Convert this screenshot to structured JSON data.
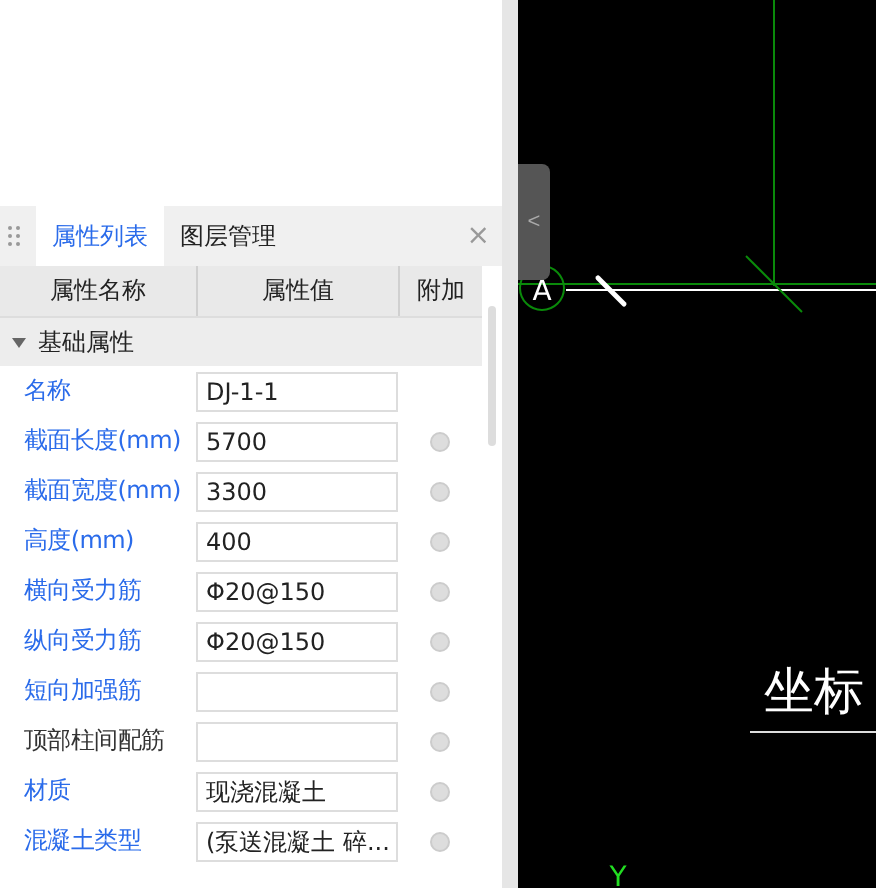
{
  "panel": {
    "tabs": [
      {
        "label": "属性列表",
        "selected": true
      },
      {
        "label": "图层管理",
        "selected": false
      }
    ],
    "close": "×",
    "columns": [
      "属性名称",
      "属性值",
      "附加"
    ],
    "group": {
      "label": "基础属性",
      "expanded": true
    },
    "rows": [
      {
        "name": "名称",
        "value": "DJ-1-1",
        "color": "#2a6bea",
        "attach": false
      },
      {
        "name": "截面长度(mm)",
        "value": "5700",
        "color": "#2a6bea",
        "attach": true
      },
      {
        "name": "截面宽度(mm)",
        "value": "3300",
        "color": "#2a6bea",
        "attach": true
      },
      {
        "name": "高度(mm)",
        "value": "400",
        "color": "#2a6bea",
        "attach": true
      },
      {
        "name": "横向受力筋",
        "value": "Φ20@150",
        "color": "#2a6bea",
        "attach": true
      },
      {
        "name": "纵向受力筋",
        "value": "Φ20@150",
        "color": "#2a6bea",
        "attach": true
      },
      {
        "name": "短向加强筋",
        "color": "#2a6bea",
        "attach": true
      },
      {
        "name": "顶部柱间配筋",
        "color": "#333333",
        "attach": true
      },
      {
        "name": "材质",
        "value": "现浇混凝土",
        "color": "#2a6bea",
        "attach": true
      },
      {
        "name": "混凝土类型",
        "value": "(泵送混凝土 碎...",
        "color": "#2a6bea",
        "attach": true
      }
    ]
  },
  "canvas": {
    "collapse": "<",
    "axis_label": "A",
    "text": "坐标",
    "y_axis": "Y"
  }
}
